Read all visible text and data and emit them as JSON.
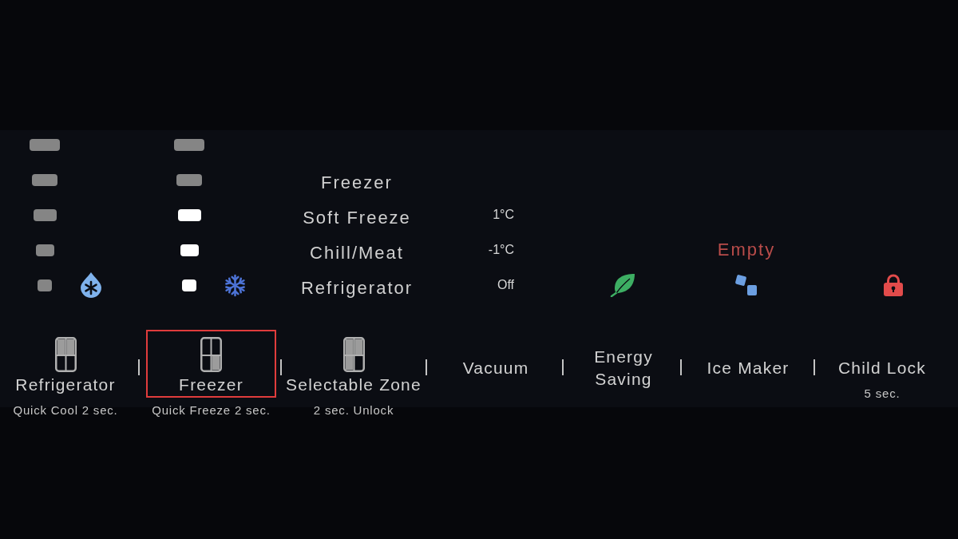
{
  "temperature_levels": [
    {
      "kind": "refrigerator",
      "segments": [
        {
          "on": false
        },
        {
          "on": false
        },
        {
          "on": false
        },
        {
          "on": false
        },
        {
          "on": false
        }
      ]
    },
    {
      "kind": "freezer",
      "segments": [
        {
          "on": false
        },
        {
          "on": false
        },
        {
          "on": true
        },
        {
          "on": true
        },
        {
          "on": true
        }
      ]
    }
  ],
  "selectable_zone_modes": [
    {
      "label": "Freezer"
    },
    {
      "label": "Soft Freeze",
      "temperature": "1°C"
    },
    {
      "label": "Chill/Meat",
      "temperature": "-1°C"
    },
    {
      "label": "Refrigerator",
      "temperature": "Off"
    }
  ],
  "ice_maker_status": "Empty",
  "buttons": [
    {
      "kind": "refrigerator",
      "label": "Refrigerator",
      "caption": "Quick Cool 2 sec.",
      "selected": false
    },
    {
      "kind": "freezer",
      "label": "Freezer",
      "caption": "Quick Freeze 2 sec.",
      "selected": true
    },
    {
      "kind": "selectable_zone",
      "label": "Selectable Zone",
      "caption": "2 sec. Unlock",
      "selected": false
    },
    {
      "kind": "plain",
      "label": "Vacuum",
      "selected": false
    },
    {
      "kind": "plain",
      "label": "Energy Saving",
      "selected": false
    },
    {
      "kind": "plain",
      "label": "Ice Maker",
      "selected": false
    },
    {
      "kind": "plain",
      "label": "Child Lock",
      "caption": "5 sec.",
      "selected": false
    }
  ]
}
